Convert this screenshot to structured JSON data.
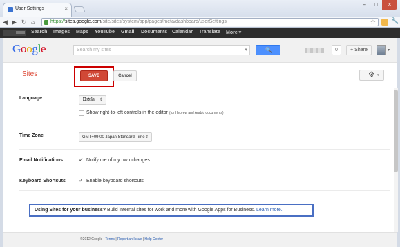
{
  "browser": {
    "tab_title": "User Settings",
    "tab_close": "×",
    "url_scheme": "https://",
    "url_host": "sites.google.com",
    "url_path": "/site/sites/system/app/pages/meta/dashboard/userSettings",
    "window_controls": [
      "–",
      "□",
      "×"
    ],
    "nav": {
      "back": "◀",
      "forward": "▶",
      "reload": "↻",
      "home": "⌂"
    },
    "star": "☆",
    "wrench": "🔧"
  },
  "gbar": {
    "items": [
      "Search",
      "Images",
      "Maps",
      "YouTube",
      "Gmail",
      "Documents",
      "Calendar",
      "Translate",
      "More ▾"
    ]
  },
  "header": {
    "logo_letters": [
      {
        "char": "G",
        "color": "#3369e8"
      },
      {
        "char": "o",
        "color": "#d50f25"
      },
      {
        "char": "o",
        "color": "#eeb211"
      },
      {
        "char": "g",
        "color": "#3369e8"
      },
      {
        "char": "l",
        "color": "#009925"
      },
      {
        "char": "e",
        "color": "#d50f25"
      }
    ],
    "search_placeholder": "Search my sites",
    "search_caret": "▾",
    "search_button_icon": "🔍",
    "notification_count": "0",
    "share_label": "+ Share",
    "avatar_caret": "▾"
  },
  "actions": {
    "sites_title": "Sites",
    "save_label": "SAVE",
    "cancel_label": "Cancel",
    "gear_icon": "⚙",
    "gear_caret": "▾"
  },
  "settings": {
    "language_label": "Language",
    "language_value": "日本語",
    "select_arrows": "⇕",
    "rtl_label": "Show right-to-left controls in the editor",
    "rtl_note": "(for Hebrew and Arabic documents)",
    "timezone_label": "Time Zone",
    "timezone_value": "GMT+09:00 Japan Standard Time",
    "email_label": "Email Notifications",
    "email_option": "Notify me of my own changes",
    "shortcuts_label": "Keyboard Shortcuts",
    "shortcuts_option": "Enable keyboard shortcuts",
    "check_mark": "✓"
  },
  "banner": {
    "bold": "Using Sites for your business?",
    "text": " Build internal sites for work and more with Google Apps for Business. ",
    "link": "Learn more."
  },
  "footer": {
    "copyright": "©2012 Google | ",
    "terms": "Terms",
    "sep1": " | ",
    "report": "Report an Issue",
    "sep2": " | ",
    "help": "Help Center"
  }
}
